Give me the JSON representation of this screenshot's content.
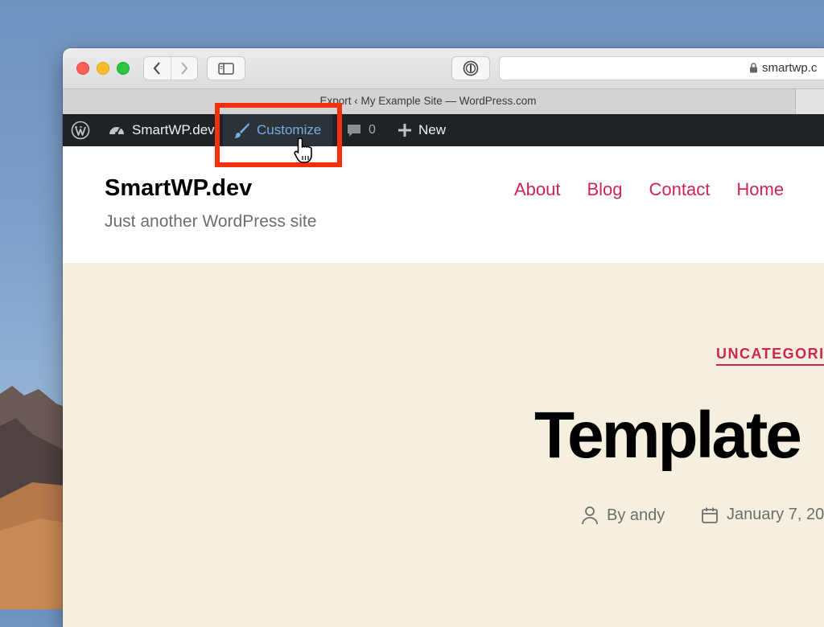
{
  "browser": {
    "address_text": "smartwp.c",
    "tab_title": "Export ‹ My Example Site — WordPress.com"
  },
  "admin_bar": {
    "site_name": "SmartWP.dev",
    "customize_label": "Customize",
    "comments_count": "0",
    "new_label": "New",
    "customize_color": "#72aee6"
  },
  "site": {
    "title": "SmartWP.dev",
    "description": "Just another WordPress site",
    "menu": [
      "About",
      "Blog",
      "Contact",
      "Home"
    ],
    "accent_color": "#cd2653"
  },
  "post": {
    "category": "UNCATEGORI",
    "title": "Template",
    "author": "By andy",
    "date": "January 7, 20"
  },
  "annotation": {
    "highlight_color": "#f4300e"
  }
}
